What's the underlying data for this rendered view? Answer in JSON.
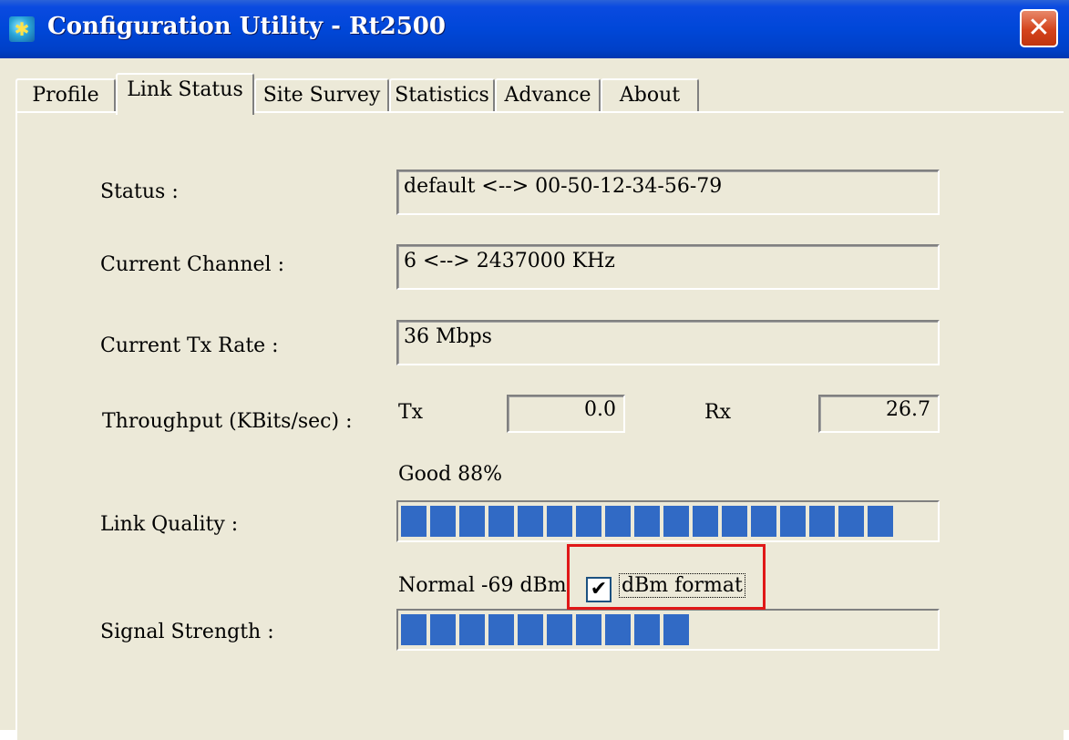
{
  "window": {
    "title": "Configuration Utility - Rt2500",
    "close_glyph": "✕"
  },
  "tabs": [
    {
      "label": "Profile",
      "active": false
    },
    {
      "label": "Link Status",
      "active": true
    },
    {
      "label": "Site Survey",
      "active": false
    },
    {
      "label": "Statistics",
      "active": false
    },
    {
      "label": "Advance",
      "active": false
    },
    {
      "label": "About",
      "active": false
    }
  ],
  "link_status": {
    "status_label": "Status :",
    "status_value": "default <--> 00-50-12-34-56-79",
    "channel_label": "Current Channel :",
    "channel_value": "6 <--> 2437000 KHz",
    "tx_rate_label": "Current Tx Rate :",
    "tx_rate_value": "36 Mbps",
    "throughput_label": "Throughput (KBits/sec) :",
    "tx_label": "Tx",
    "tx_value": "0.0",
    "rx_label": "Rx",
    "rx_value": "26.7",
    "link_quality_text": "Good 88%",
    "link_quality_label": "Link Quality :",
    "link_quality_percent": 88,
    "signal_text": "Normal -69 dBm",
    "signal_label": "Signal Strength :",
    "signal_filled_segments": 10,
    "dbm_format_label": "dBm format",
    "dbm_format_checked": true
  },
  "colors": {
    "bar_fill": "#316ac5",
    "highlight_box": "#e01818",
    "titlebar": "#0047d8"
  }
}
